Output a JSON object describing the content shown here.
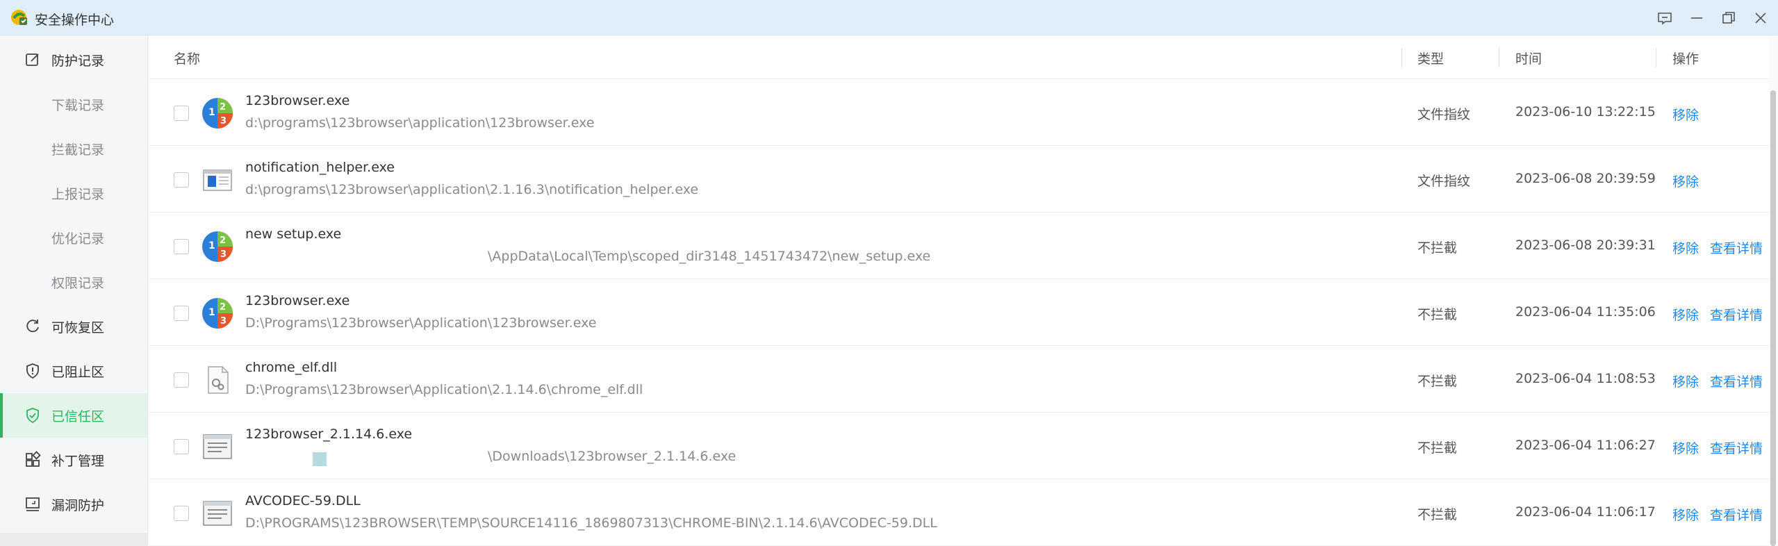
{
  "window": {
    "title": "安全操作中心",
    "controls": [
      "feedback-icon",
      "minimize-icon",
      "restore-icon",
      "close-icon"
    ]
  },
  "sidebar": {
    "items": [
      {
        "label": "防护记录",
        "icon": "edit-icon",
        "sub": false
      },
      {
        "label": "下载记录",
        "sub": true
      },
      {
        "label": "拦截记录",
        "sub": true
      },
      {
        "label": "上报记录",
        "sub": true
      },
      {
        "label": "优化记录",
        "sub": true
      },
      {
        "label": "权限记录",
        "sub": true
      },
      {
        "label": "可恢复区",
        "icon": "refresh-icon",
        "sub": false
      },
      {
        "label": "已阻止区",
        "icon": "shield-alert-icon",
        "sub": false
      },
      {
        "label": "已信任区",
        "icon": "shield-check-icon",
        "sub": false,
        "active": true
      },
      {
        "label": "补丁管理",
        "icon": "grid-icon",
        "sub": false
      },
      {
        "label": "漏洞防护",
        "icon": "monitor-icon",
        "sub": false
      }
    ]
  },
  "table": {
    "headers": {
      "name": "名称",
      "type": "类型",
      "time": "时间",
      "action": "操作"
    },
    "rows": [
      {
        "name": "123browser.exe",
        "path": "d:\\programs\\123browser\\application\\123browser.exe",
        "type": "文件指纹",
        "time": "2023-06-10 13:22:15",
        "remove": "移除",
        "details": "",
        "icon": "browser-app-icon"
      },
      {
        "name": "notification_helper.exe",
        "path": "d:\\programs\\123browser\\application\\2.1.16.3\\notification_helper.exe",
        "type": "文件指纹",
        "time": "2023-06-08 20:39:59",
        "remove": "移除",
        "details": "",
        "icon": "window-app-icon"
      },
      {
        "name": "new setup.exe",
        "path": "\\AppData\\Local\\Temp\\scoped_dir3148_1451743472\\new_setup.exe",
        "type": "不拦截",
        "time": "2023-06-08 20:39:31",
        "remove": "移除",
        "details": "查看详情",
        "icon": "browser-app-icon"
      },
      {
        "name": "123browser.exe",
        "path": "D:\\Programs\\123browser\\Application\\123browser.exe",
        "type": "不拦截",
        "time": "2023-06-04 11:35:06",
        "remove": "移除",
        "details": "查看详情",
        "icon": "browser-app-icon"
      },
      {
        "name": "chrome_elf.dll",
        "path": "D:\\Programs\\123browser\\Application\\2.1.14.6\\chrome_elf.dll",
        "type": "不拦截",
        "time": "2023-06-04 11:08:53",
        "remove": "移除",
        "details": "查看详情",
        "icon": "dll-file-icon"
      },
      {
        "name": "123browser_2.1.14.6.exe",
        "path": "\\Downloads\\123browser_2.1.14.6.exe",
        "type": "不拦截",
        "time": "2023-06-04 11:06:27",
        "remove": "移除",
        "details": "查看详情",
        "icon": "installer-icon"
      },
      {
        "name": "AVCODEC-59.DLL",
        "path": "D:\\PROGRAMS\\123BROWSER\\TEMP\\SOURCE14116_1869807313\\CHROME-BIN\\2.1.14.6\\AVCODEC-59.DLL",
        "type": "不拦截",
        "time": "2023-06-04 11:06:17",
        "remove": "移除",
        "details": "查看详情",
        "icon": "installer-icon"
      }
    ]
  },
  "colors": {
    "accent_green": "#2db45f",
    "link_blue": "#2a86e3",
    "titlebar_bg": "#dfeef9"
  }
}
